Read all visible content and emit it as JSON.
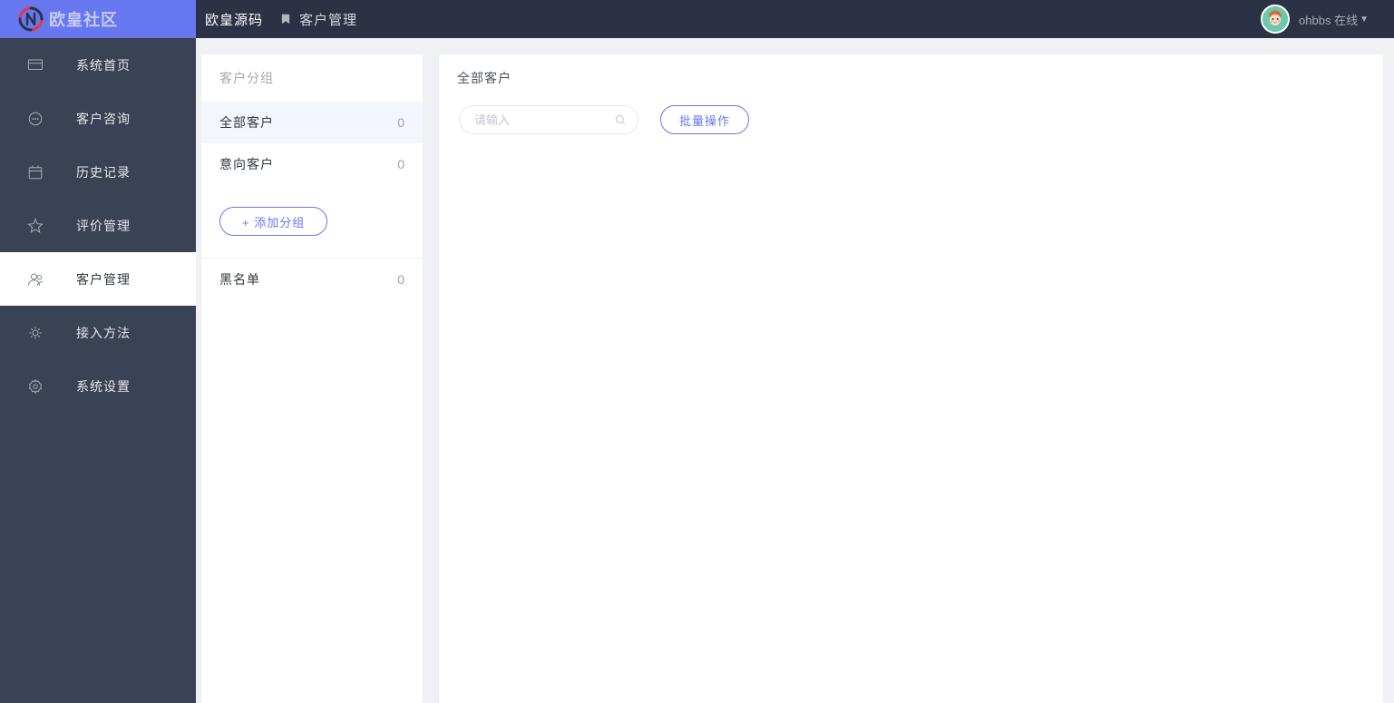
{
  "header": {
    "logo_text": "欧皇社区",
    "brand": "欧皇源码",
    "page_title": "客户管理",
    "user_name": "ohbbs 在线"
  },
  "sidebar": {
    "items": [
      {
        "label": "系统首页",
        "icon": "monitor"
      },
      {
        "label": "客户咨询",
        "icon": "chat"
      },
      {
        "label": "历史记录",
        "icon": "calendar"
      },
      {
        "label": "评价管理",
        "icon": "star"
      },
      {
        "label": "客户管理",
        "icon": "users",
        "active": true
      },
      {
        "label": "接入方法",
        "icon": "plug"
      },
      {
        "label": "系统设置",
        "icon": "gear"
      }
    ]
  },
  "group_panel": {
    "title": "客户分组",
    "items": [
      {
        "label": "全部客户",
        "count": "0",
        "active": true
      },
      {
        "label": "意向客户",
        "count": "0"
      }
    ],
    "add_button": "+ 添加分组",
    "blacklist": {
      "label": "黑名单",
      "count": "0"
    }
  },
  "main": {
    "title": "全部客户",
    "search_placeholder": "请输入",
    "batch_button": "批量操作"
  }
}
